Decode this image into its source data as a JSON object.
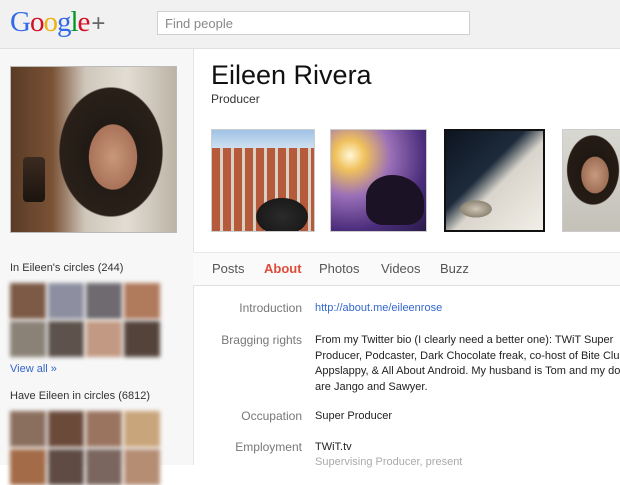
{
  "header": {
    "logo_letters": [
      "G",
      "o",
      "o",
      "g",
      "l",
      "e"
    ],
    "logo_plus": "+",
    "search_placeholder": "Find people"
  },
  "profile": {
    "name": "Eileen Rivera",
    "title": "Producer"
  },
  "left": {
    "in_circles_title": "In Eileen's circles (244)",
    "view_all": "View all »",
    "have_in_circles_title": "Have Eileen in circles (6812)"
  },
  "tabs": [
    "Posts",
    "About",
    "Photos",
    "Videos",
    "Buzz"
  ],
  "active_tab": "About",
  "about": {
    "introduction_label": "Introduction",
    "introduction_value": "http://about.me/eileenrose",
    "bragging_label": "Bragging rights",
    "bragging_lines": [
      "From my Twitter bio (I clearly need a better one): TWiT Super",
      "Producer, Podcaster, Dark Chocolate freak, co-host of Bite Club,",
      "Appslappy, & All About Android. My husband is Tom and my dog",
      "are Jango and Sawyer."
    ],
    "occupation_label": "Occupation",
    "occupation_value": "Super Producer",
    "employment_label": "Employment",
    "employment_value": "TWiT.tv",
    "employment_sub": "Supervising Producer, present"
  },
  "colors": {
    "active_tab": "#dd4b39",
    "link": "#3366cc"
  }
}
